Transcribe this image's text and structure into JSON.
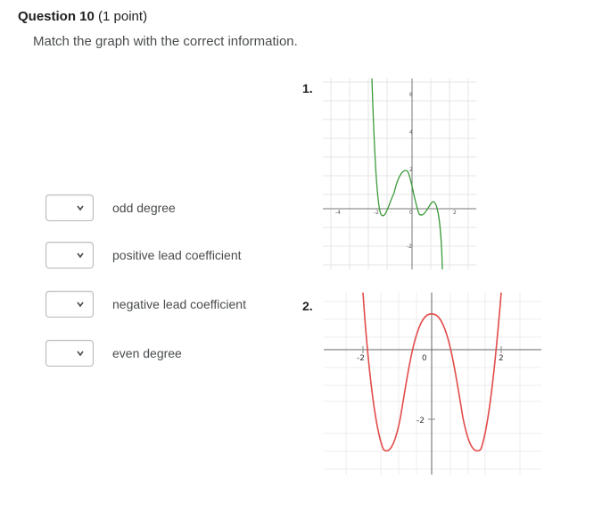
{
  "question": {
    "title": "Question 10",
    "points": "(1 point)",
    "prompt": "Match the graph with the correct information."
  },
  "match_items": [
    {
      "label": "odd degree",
      "selected": ""
    },
    {
      "label": "positive lead coefficient",
      "selected": ""
    },
    {
      "label": "negative lead coefficient",
      "selected": ""
    },
    {
      "label": "even degree",
      "selected": ""
    }
  ],
  "graphs": [
    {
      "number": "1.",
      "curve_color": "#3b9b3b",
      "x_ticks": [
        "-4",
        "-2",
        "0",
        "2"
      ],
      "y_ticks": [
        "6",
        "4",
        "2",
        "-2"
      ]
    },
    {
      "number": "2.",
      "curve_color": "#e24b4b",
      "x_ticks": [
        "-2",
        "0",
        "2"
      ],
      "y_ticks": [
        "-2"
      ]
    }
  ]
}
